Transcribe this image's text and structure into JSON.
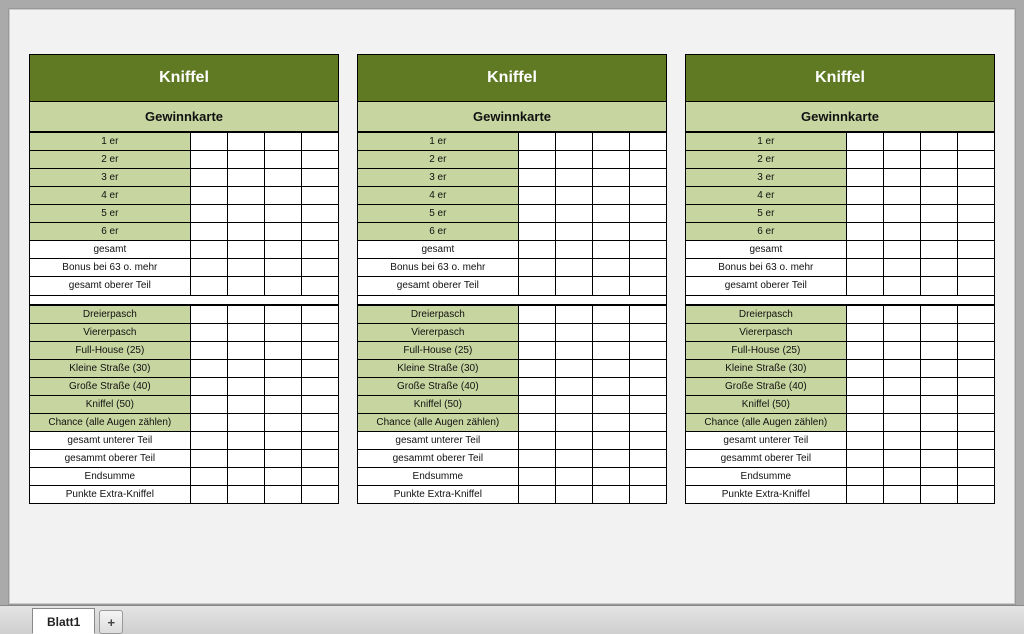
{
  "card": {
    "title": "Kniffel",
    "subtitle": "Gewinnkarte",
    "upper": [
      {
        "label": "1 er",
        "shaded": true
      },
      {
        "label": "2 er",
        "shaded": true
      },
      {
        "label": "3 er",
        "shaded": true
      },
      {
        "label": "4 er",
        "shaded": true
      },
      {
        "label": "5 er",
        "shaded": true
      },
      {
        "label": "6 er",
        "shaded": true
      },
      {
        "label": "gesamt",
        "shaded": false
      },
      {
        "label": "Bonus bei 63 o. mehr",
        "shaded": false
      },
      {
        "label": "gesamt oberer Teil",
        "shaded": false
      }
    ],
    "lower": [
      {
        "label": "Dreierpasch",
        "shaded": true
      },
      {
        "label": "Viererpasch",
        "shaded": true
      },
      {
        "label": "Full-House (25)",
        "shaded": true
      },
      {
        "label": "Kleine Straße (30)",
        "shaded": true
      },
      {
        "label": "Große Straße (40)",
        "shaded": true
      },
      {
        "label": "Kniffel (50)",
        "shaded": true
      },
      {
        "label": "Chance (alle Augen zählen)",
        "shaded": true
      },
      {
        "label": "gesamt unterer Teil",
        "shaded": false
      },
      {
        "label": "gesammt oberer Teil",
        "shaded": false
      },
      {
        "label": "Endsumme",
        "shaded": false
      },
      {
        "label": "Punkte Extra-Kniffel",
        "shaded": false
      }
    ],
    "scoreColumns": 4
  },
  "cardCount": 3,
  "tabs": {
    "active": "Blatt1",
    "addGlyph": "+"
  }
}
